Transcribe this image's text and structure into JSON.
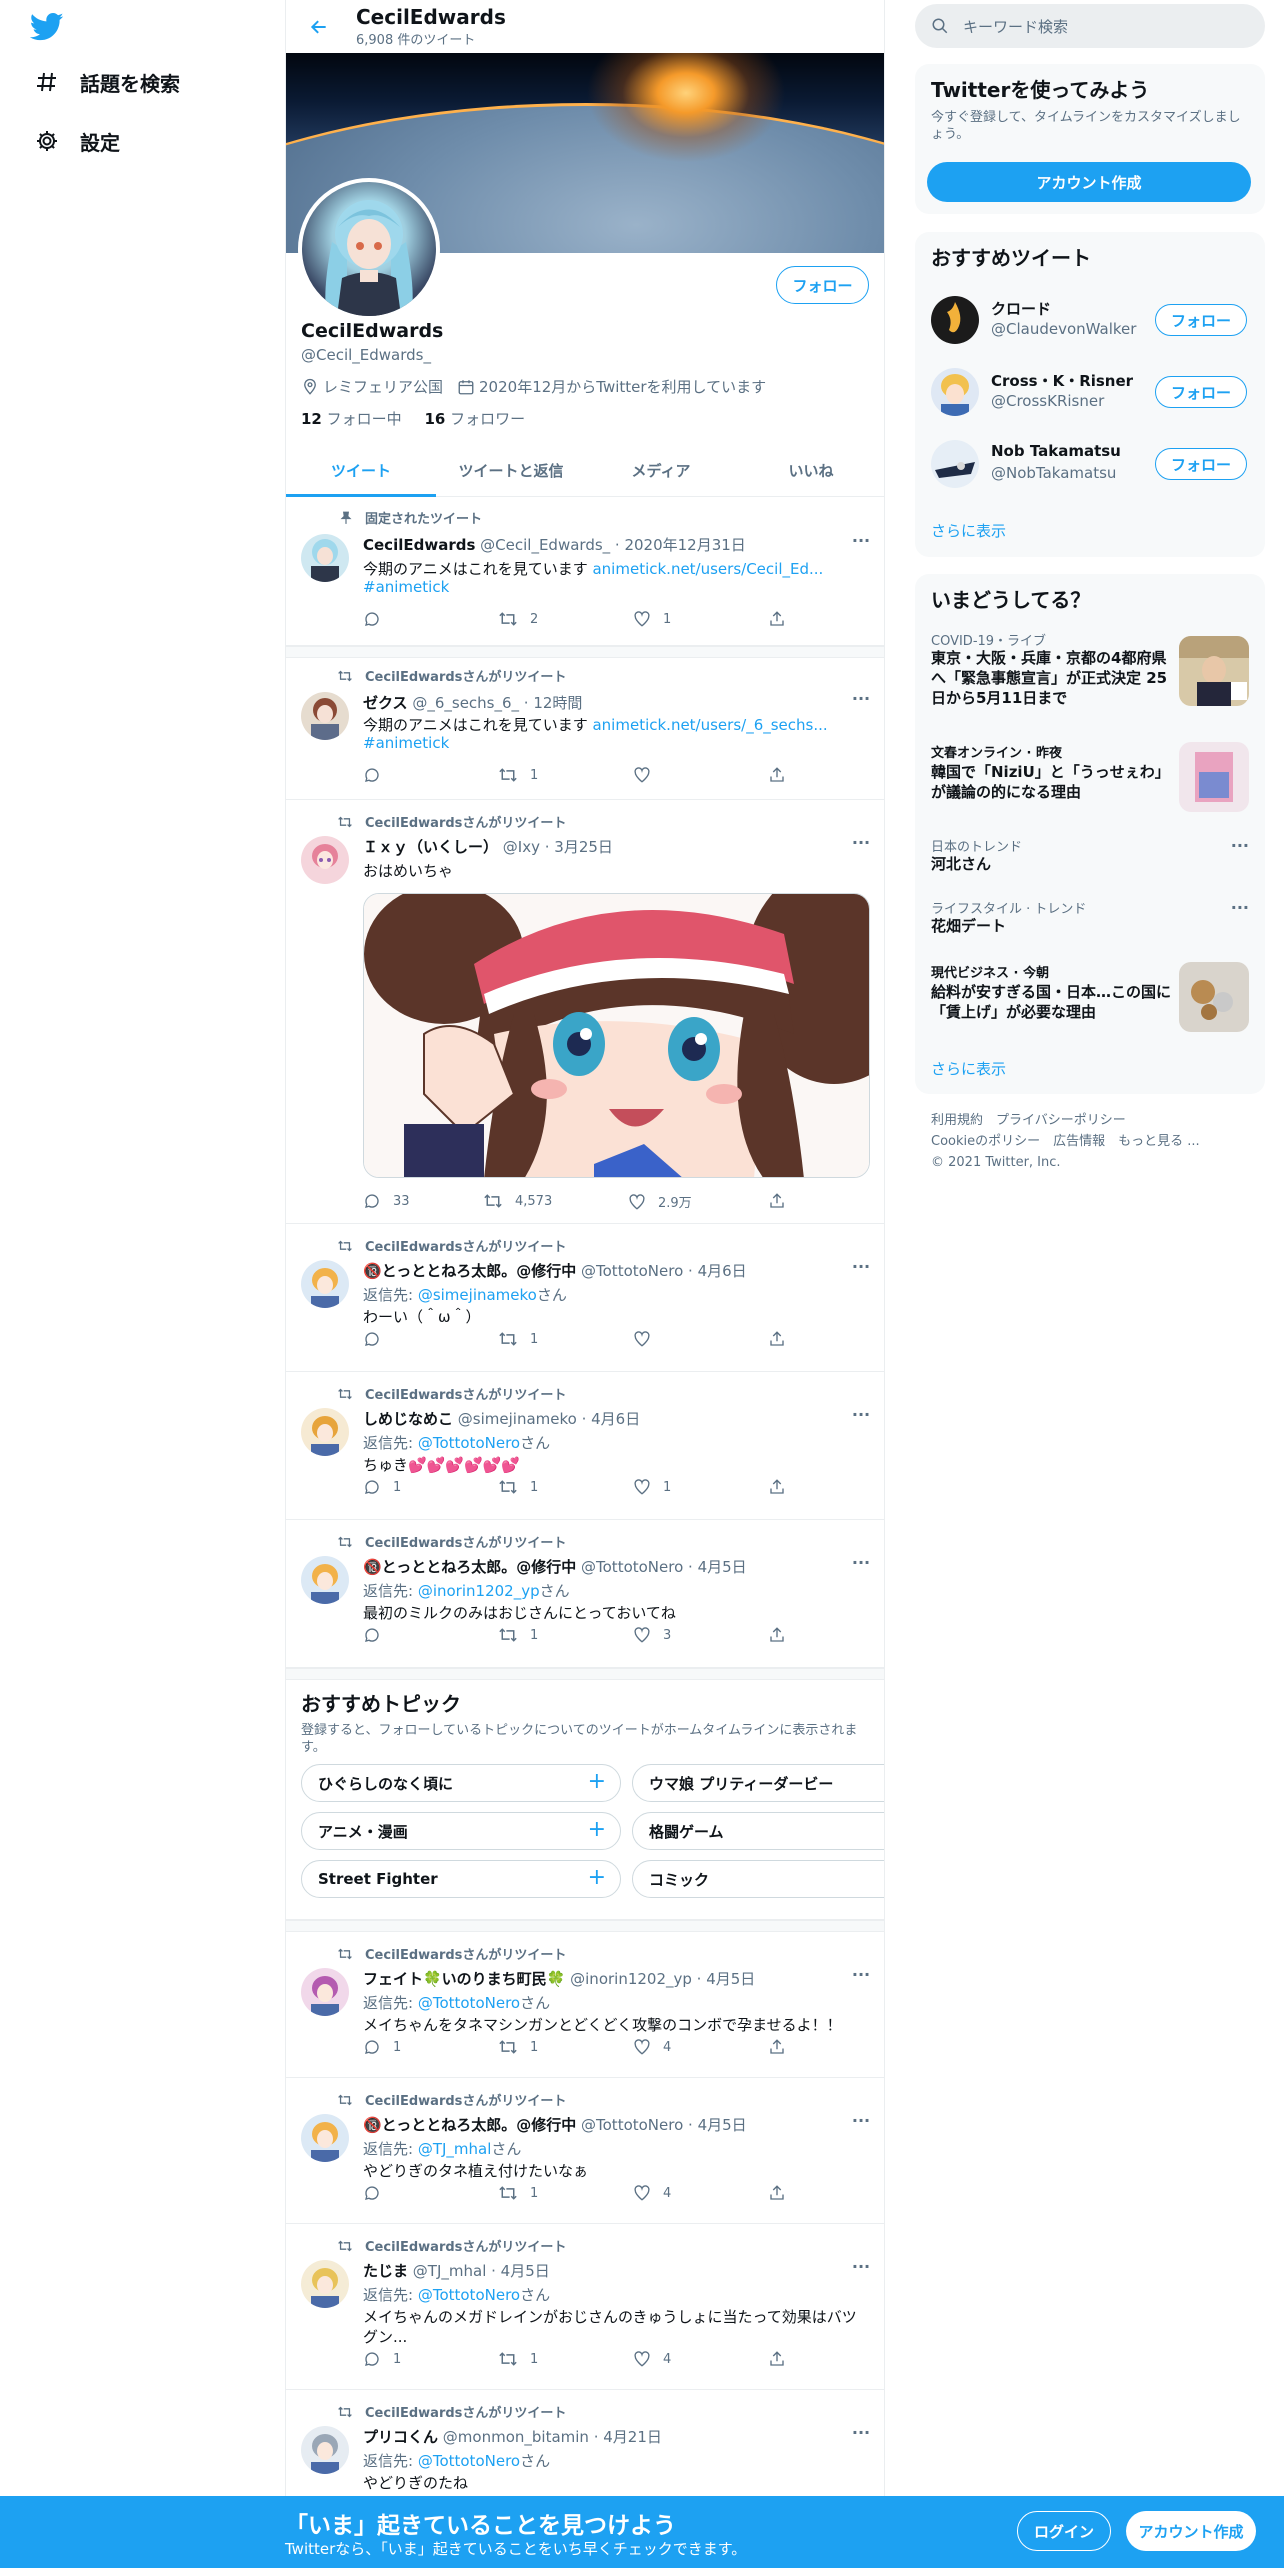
{
  "nav": {
    "explore_label": "話題を検索",
    "settings_label": "設定"
  },
  "header": {
    "name": "CecilEdwards",
    "tweet_count": "6,908 件のツイート"
  },
  "profile": {
    "name": "CecilEdwards",
    "handle": "@Cecil_Edwards_",
    "follow_label": "フォロー",
    "location": "レミフェリア公国",
    "joined": "2020年12月からTwitterを利用しています",
    "following_count": "12",
    "following_label": "フォロー中",
    "followers_count": "16",
    "followers_label": "フォロワー"
  },
  "tabs": [
    "ツイート",
    "ツイートと返信",
    "メディア",
    "いいね"
  ],
  "tweets": [
    {
      "context": "固定されたツイート",
      "name": "CecilEdwards",
      "meta": "@Cecil_Edwards_ · 2020年12月31日",
      "text": "今期のアニメはこれを見ています ",
      "link": "animetick.net/users/Cecil_Ed...",
      "hashtag": "#animetick",
      "reply": "",
      "retweet": "2",
      "like": "1"
    },
    {
      "context": "CecilEdwardsさんがリツイート",
      "name": "ゼクス",
      "meta": "@_6_sechs_6_ · 12時間",
      "text": "今期のアニメはこれを見ています ",
      "link": "animetick.net/users/_6_sechs...",
      "hashtag": "#animetick",
      "reply": "",
      "retweet": "1",
      "like": ""
    },
    {
      "context": "CecilEdwardsさんがリツイート",
      "name": "Ｉｘｙ（いくしー）",
      "meta": "@Ixy · 3月25日",
      "text": "おはめいちゃ",
      "reply": "33",
      "retweet": "4,573",
      "like": "2.9万"
    },
    {
      "context": "CecilEdwardsさんがリツイート",
      "name": "🔞とっととねろ太郎。@修行中",
      "meta": "@TottotoNero · 4月6日",
      "reply_prefix": "返信先: ",
      "reply_to": "@simejinameko",
      "reply_suffix": "さん",
      "text": "わーい（＾ω＾）",
      "reply": "",
      "retweet": "1",
      "like": ""
    },
    {
      "context": "CecilEdwardsさんがリツイート",
      "name": "しめじなめこ",
      "meta": "@simejinameko · 4月6日",
      "reply_prefix": "返信先: ",
      "reply_to": "@TottotoNero",
      "reply_suffix": "さん",
      "text": "ちゅき💕💕💕💕💕💕",
      "reply": "1",
      "retweet": "1",
      "like": "1"
    },
    {
      "context": "CecilEdwardsさんがリツイート",
      "name": "🔞とっととねろ太郎。@修行中",
      "meta": "@TottotoNero · 4月5日",
      "reply_prefix": "返信先: ",
      "reply_to": "@inorin1202_yp",
      "reply_suffix": "さん",
      "text": "最初のミルクのみはおじさんにとっておいてね",
      "reply": "",
      "retweet": "1",
      "like": "3"
    },
    {
      "context": "CecilEdwardsさんがリツイート",
      "name": "フェイト🍀いのりまち町民🍀",
      "meta": "@inorin1202_yp · 4月5日",
      "reply_prefix": "返信先: ",
      "reply_to": "@TottotoNero",
      "reply_suffix": "さん",
      "text": "メイちゃんをタネマシンガンとどくどく攻撃のコンボで孕ませるよ！！",
      "reply": "1",
      "retweet": "1",
      "like": "4"
    },
    {
      "context": "CecilEdwardsさんがリツイート",
      "name": "🔞とっととねろ太郎。@修行中",
      "meta": "@TottotoNero · 4月5日",
      "reply_prefix": "返信先: ",
      "reply_to": "@TJ_mhal",
      "reply_suffix": "さん",
      "text": "やどりぎのタネ植え付けたいなぁ",
      "reply": "",
      "retweet": "1",
      "like": "4"
    },
    {
      "context": "CecilEdwardsさんがリツイート",
      "name": "たじま",
      "meta": "@TJ_mhal · 4月5日",
      "reply_prefix": "返信先: ",
      "reply_to": "@TottotoNero",
      "reply_suffix": "さん",
      "text": "メイちゃんのメガドレインがおじさんのきゅうしょに当たって効果はバツ",
      "text2": "グン...",
      "reply": "1",
      "retweet": "1",
      "like": "4"
    },
    {
      "context": "CecilEdwardsさんがリツイート",
      "name": "プリコくん",
      "meta": "@monmon_bitamin · 4月21日",
      "reply_prefix": "返信先: ",
      "reply_to": "@TottotoNero",
      "reply_suffix": "さん",
      "text": "やどりぎのたね"
    }
  ],
  "topics": {
    "title": "おすすめトピック",
    "subtitle": "登録すると、フォローしているトピックについてのツイートがホームタイムラインに表示されます。",
    "items": [
      "ひぐらしのなく頃に",
      "ウマ娘 プリティーダービー",
      "アニメ・漫画",
      "格闘ゲーム",
      "Street Fighter",
      "コミック"
    ]
  },
  "search": {
    "placeholder": "キーワード検索"
  },
  "signup_card": {
    "title": "Twitterを使ってみよう",
    "desc": "今すぐ登録して、タイムラインをカスタマイズしましょう。",
    "button": "アカウント作成"
  },
  "who_to_follow": {
    "title": "おすすめツイート",
    "users": [
      {
        "name": "クロード",
        "handle": "@ClaudevonWalker",
        "follow": "フォロー"
      },
      {
        "name": "Cross・K・Risner",
        "handle": "@CrossKRisner",
        "follow": "フォロー"
      },
      {
        "name": "Nob Takamatsu",
        "handle": "@NobTakamatsu",
        "follow": "フォロー"
      }
    ],
    "more": "さらに表示"
  },
  "trends": {
    "title": "いまどうしてる？",
    "items": [
      {
        "meta": "COVID-19・ライブ",
        "text": "東京・大阪・兵庫・京都の4都府県へ「緊急事態宣言」が正式決定 25日から5月11日まで"
      },
      {
        "meta": "文春オンライン · 昨夜",
        "text": "韓国で「NiziU」と「うっせぇわ」が議論の的になる理由"
      },
      {
        "meta": "日本のトレンド",
        "text": "河北さん"
      },
      {
        "meta": "ライフスタイル · トレンド",
        "text": "花畑デート"
      },
      {
        "meta": "現代ビジネス · 今朝",
        "text": "給料が安すぎる国・日本…この国に「賃上げ」が必要な理由"
      }
    ],
    "more": "さらに表示"
  },
  "footer": {
    "line1": "利用規約　プライバシーポリシー",
    "line2": "Cookieのポリシー　広告情報　もっと見る ...",
    "line3": "© 2021 Twitter, Inc."
  },
  "bottom_bar": {
    "title": "「いま」起きていることを見つけよう",
    "subtitle": "Twitterなら、「いま」起きていることをいち早くチェックできます。",
    "login": "ログイン",
    "signup": "アカウント作成"
  },
  "colors": {
    "accent": "#1da1f2",
    "text": "#0f1419",
    "muted": "#5b7083"
  }
}
